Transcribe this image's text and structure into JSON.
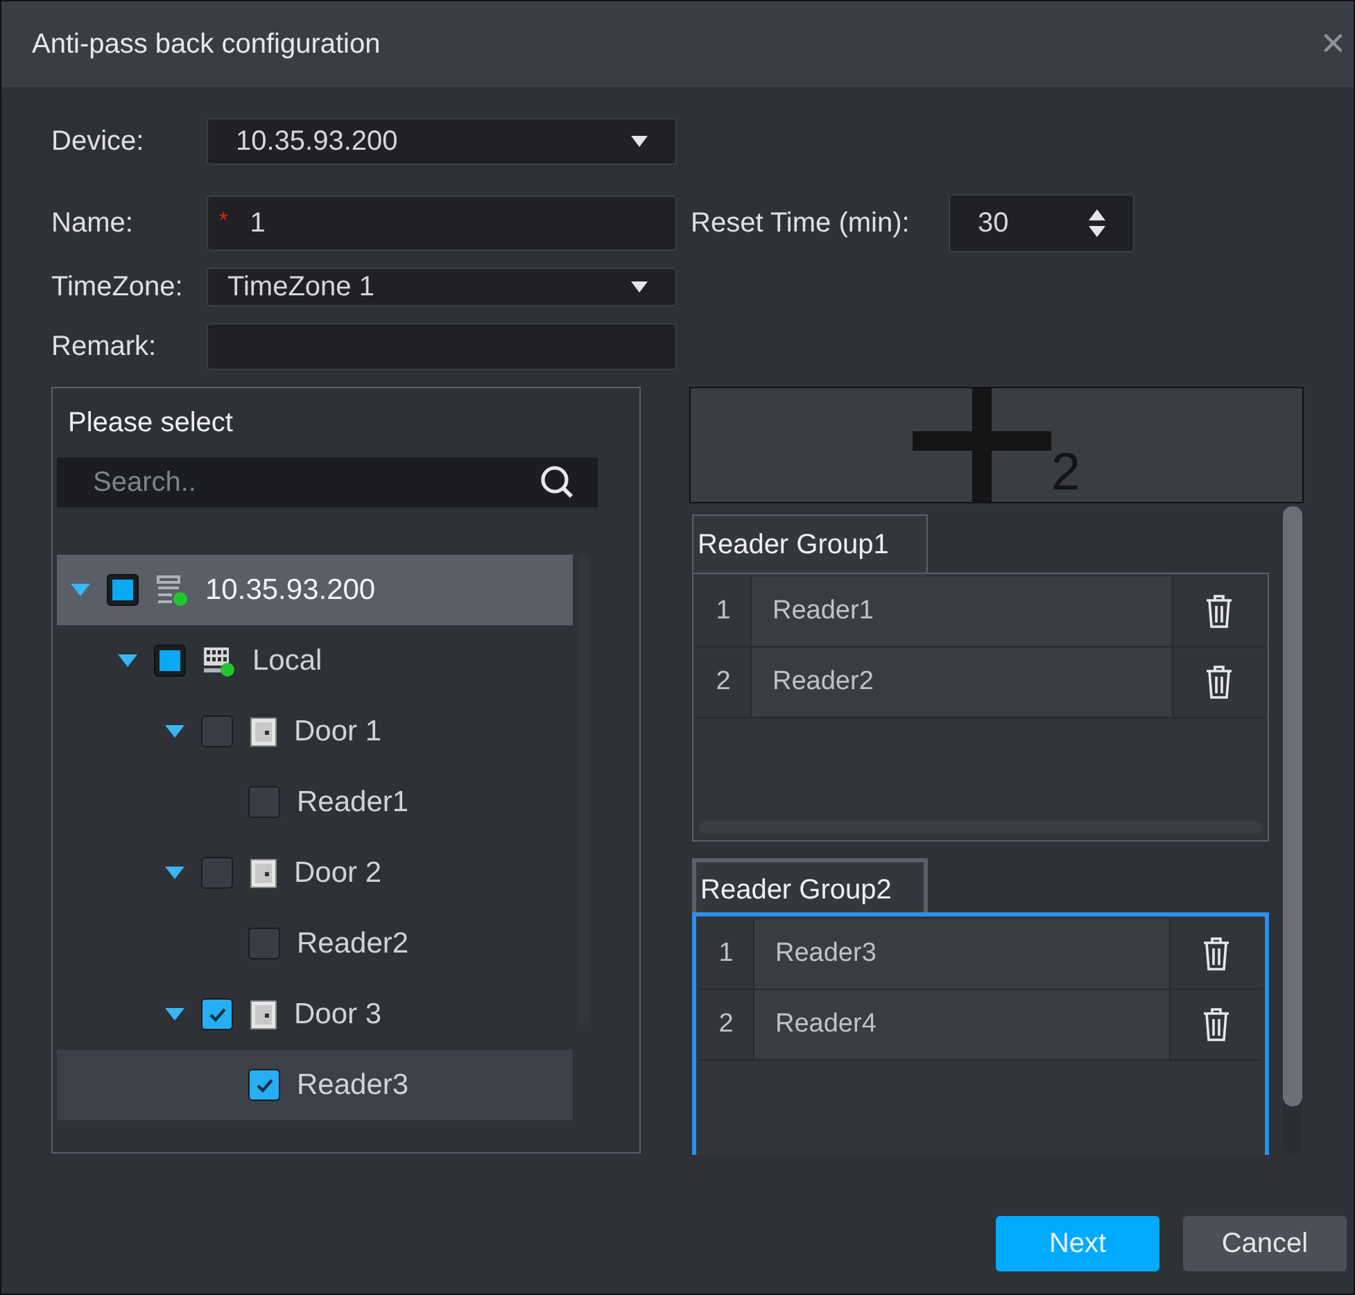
{
  "window": {
    "title": "Anti-pass back configuration",
    "close": "×"
  },
  "form": {
    "device": {
      "label": "Device:",
      "value": "10.35.93.200"
    },
    "name": {
      "label": "Name:",
      "required_mark": "*",
      "value": "1"
    },
    "reset_time": {
      "label": "Reset Time (min):",
      "value": "30"
    },
    "timezone": {
      "label": "TimeZone:",
      "value": "TimeZone 1"
    },
    "remark": {
      "label": "Remark:"
    }
  },
  "tree_panel": {
    "title": "Please select",
    "search": {
      "placeholder": "Search.."
    },
    "nodes": [
      {
        "kind": "device",
        "label": "10.35.93.200",
        "checked": false,
        "partial": true,
        "expanded": true,
        "selected": true,
        "online": true,
        "children": [
          {
            "kind": "local",
            "label": "Local",
            "checked": false,
            "partial": true,
            "expanded": true,
            "selected": false,
            "online": true,
            "children": [
              {
                "kind": "door",
                "label": "Door 1",
                "checked": false,
                "expanded": true,
                "selected": false,
                "children": [
                  {
                    "kind": "reader",
                    "label": "Reader1",
                    "checked": false,
                    "selected": false
                  }
                ]
              },
              {
                "kind": "door",
                "label": "Door 2",
                "checked": false,
                "expanded": true,
                "selected": false,
                "children": [
                  {
                    "kind": "reader",
                    "label": "Reader2",
                    "checked": false,
                    "selected": false
                  }
                ]
              },
              {
                "kind": "door",
                "label": "Door 3",
                "checked": true,
                "expanded": true,
                "selected": false,
                "children": [
                  {
                    "kind": "reader",
                    "label": "Reader3",
                    "checked": true,
                    "selected": false,
                    "hovered": true
                  }
                ]
              }
            ]
          }
        ]
      }
    ]
  },
  "add_group": {
    "count": "2"
  },
  "groups": [
    {
      "title": "Reader Group1",
      "selected": false,
      "rows": [
        {
          "index": "1",
          "reader": "Reader1"
        },
        {
          "index": "2",
          "reader": "Reader2"
        }
      ]
    },
    {
      "title": "Reader Group2",
      "selected": true,
      "rows": [
        {
          "index": "1",
          "reader": "Reader3"
        },
        {
          "index": "2",
          "reader": "Reader4"
        }
      ]
    }
  ],
  "buttons": [
    {
      "label": "Next",
      "kind": "primary"
    },
    {
      "label": "Cancel",
      "kind": "secondary"
    }
  ]
}
